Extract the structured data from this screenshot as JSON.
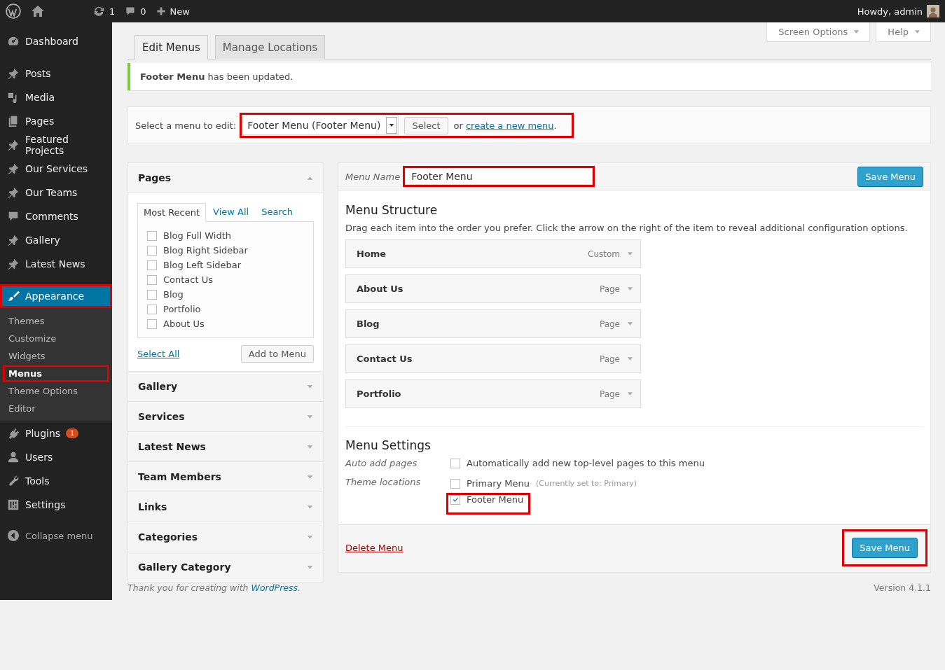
{
  "admin_bar": {
    "updates": "1",
    "comments": "0",
    "new_label": "New",
    "greeting": "Howdy, admin"
  },
  "sidebar": {
    "sections": [
      [
        {
          "label": "Dashboard",
          "selected": false,
          "highlighted": false
        }
      ],
      [
        {
          "label": "Posts",
          "selected": false,
          "highlighted": false
        },
        {
          "label": "Media",
          "selected": false,
          "highlighted": false
        },
        {
          "label": "Pages",
          "selected": false,
          "highlighted": false
        },
        {
          "label": "Featured Projects",
          "selected": false,
          "highlighted": false
        },
        {
          "label": "Our Services",
          "selected": false,
          "highlighted": false
        },
        {
          "label": "Our Teams",
          "selected": false,
          "highlighted": false
        },
        {
          "label": "Comments",
          "selected": false,
          "highlighted": false
        },
        {
          "label": "Gallery",
          "selected": false,
          "highlighted": false
        },
        {
          "label": "Latest News",
          "selected": false,
          "highlighted": false
        }
      ],
      [
        {
          "label": "Appearance",
          "selected": true,
          "highlighted": true,
          "children": [
            {
              "label": "Themes",
              "selected": false,
              "highlighted": false
            },
            {
              "label": "Customize",
              "selected": false,
              "highlighted": false
            },
            {
              "label": "Widgets",
              "selected": false,
              "highlighted": false
            },
            {
              "label": "Menus",
              "selected": true,
              "highlighted": true
            },
            {
              "label": "Theme Options",
              "selected": false,
              "highlighted": false
            },
            {
              "label": "Editor",
              "selected": false,
              "highlighted": false
            }
          ]
        }
      ],
      [
        {
          "label": "Plugins",
          "selected": false,
          "highlighted": false,
          "badge": "1"
        },
        {
          "label": "Users",
          "selected": false,
          "highlighted": false
        },
        {
          "label": "Tools",
          "selected": false,
          "highlighted": false
        },
        {
          "label": "Settings",
          "selected": false,
          "highlighted": false
        }
      ]
    ],
    "collapse": "Collapse menu"
  },
  "screen_meta": [
    "Screen Options",
    "Help"
  ],
  "tabs": [
    {
      "label": "Edit Menus",
      "selected": true
    },
    {
      "label": "Manage Locations",
      "selected": false
    }
  ],
  "notice": "**Footer Menu** has been updated.",
  "select_menu": {
    "label": "Select a menu to edit:",
    "value": "Footer Menu (Footer Menu)",
    "button": "Select",
    "or": "or",
    "link": "create a new menu",
    "end": ".",
    "highlighted": true
  },
  "left_boxes": [
    {
      "title": "Pages",
      "expanded": true,
      "tabs": [
        {
          "label": "Most Recent",
          "selected": true
        },
        {
          "label": "View All",
          "selected": false
        },
        {
          "label": "Search",
          "selected": false
        }
      ],
      "items": [
        {
          "label": "Blog Full Width",
          "checked": false
        },
        {
          "label": "Blog Right Sidebar",
          "checked": false
        },
        {
          "label": "Blog Left Sidebar",
          "checked": false
        },
        {
          "label": "Contact Us",
          "checked": false
        },
        {
          "label": "Blog",
          "checked": false
        },
        {
          "label": "Portfolio",
          "checked": false
        },
        {
          "label": "About Us",
          "checked": false
        }
      ],
      "select_all": "Select All",
      "add_button": "Add to Menu"
    },
    {
      "title": "Gallery",
      "expanded": false
    },
    {
      "title": "Services",
      "expanded": false
    },
    {
      "title": "Latest News",
      "expanded": false
    },
    {
      "title": "Team Members",
      "expanded": false
    },
    {
      "title": "Links",
      "expanded": false
    },
    {
      "title": "Categories",
      "expanded": false
    },
    {
      "title": "Gallery Category",
      "expanded": false
    }
  ],
  "menu_editor": {
    "name_label": "Menu Name",
    "name_value": "Footer Menu",
    "name_highlighted": true,
    "save_top": "Save Menu",
    "structure_title": "Menu Structure",
    "structure_hint": "Drag each item into the order you prefer. Click the arrow on the right of the item to reveal additional configuration options.",
    "items": [
      {
        "title": "Home",
        "type": "Custom"
      },
      {
        "title": "About Us",
        "type": "Page"
      },
      {
        "title": "Blog",
        "type": "Page"
      },
      {
        "title": "Contact Us",
        "type": "Page"
      },
      {
        "title": "Portfolio",
        "type": "Page"
      }
    ],
    "settings_title": "Menu Settings",
    "auto_add": {
      "label": "Auto add pages",
      "option": "Automatically add new top-level pages to this menu",
      "checked": false
    },
    "locations_label": "Theme locations",
    "locations": [
      {
        "label": "Primary Menu",
        "note": "(Currently set to: Primary)",
        "checked": false,
        "highlighted": false
      },
      {
        "label": "Footer Menu",
        "checked": true,
        "highlighted": true
      }
    ],
    "delete": "Delete Menu",
    "save_bottom": "Save Menu",
    "save_bottom_highlighted": true
  },
  "footer": {
    "thanks": "Thank you for creating with",
    "link": "WordPress",
    "end": ".",
    "version": "Version 4.1.1"
  }
}
